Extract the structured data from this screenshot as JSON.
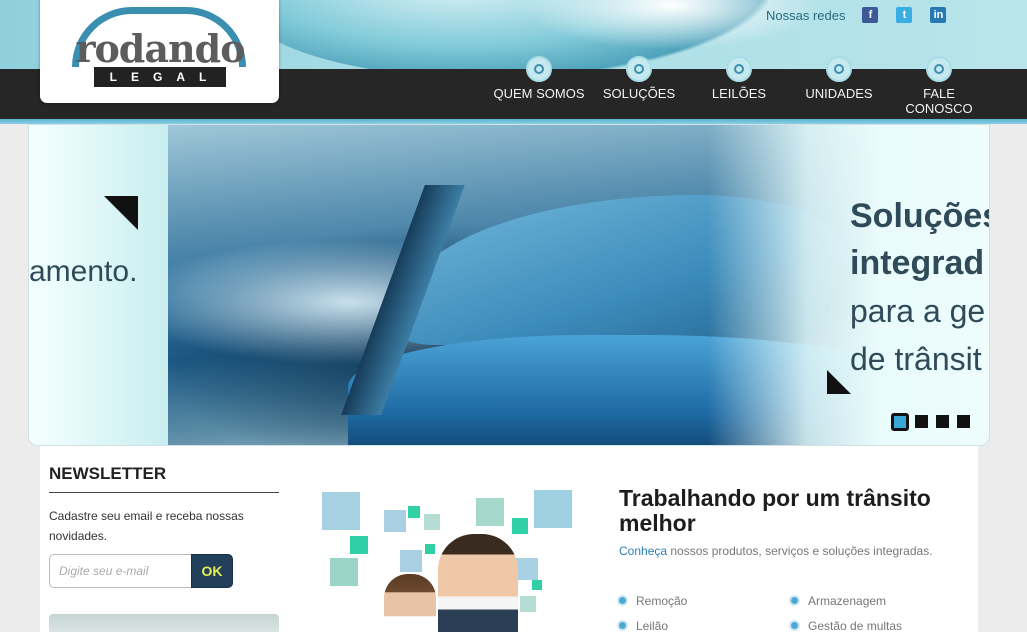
{
  "brand": {
    "logo_main": "rodando",
    "logo_sub": "LEGAL"
  },
  "social": {
    "label": "Nossas redes",
    "icons": [
      "facebook-icon",
      "twitter-icon",
      "linkedin-icon"
    ]
  },
  "nav": {
    "items": [
      {
        "label": "QUEM SOMOS"
      },
      {
        "label": "SOLUÇÕES"
      },
      {
        "label": "LEILÕES"
      },
      {
        "label": "UNIDADES"
      },
      {
        "label": "FALE CONOSCO"
      }
    ]
  },
  "slider": {
    "left_fragment": "amento.",
    "headline_line1": "Soluções",
    "headline_line2": "integrad",
    "headline_line3": "para a ge",
    "headline_line4": "de trânsit",
    "pages": 4,
    "active_page": 1
  },
  "newsletter": {
    "title": "NEWSLETTER",
    "description": "Cadastre seu email e receba nossas novidades.",
    "input_placeholder": "Digite seu e-mail",
    "button_label": "OK"
  },
  "feature": {
    "title": "Trabalhando por um trânsito melhor",
    "desc_link": "Conheça",
    "desc_rest": " nossos produtos, serviços e soluções integradas.",
    "items": [
      "Remoção",
      "Armazenagem",
      "Leilão",
      "Gestão de multas"
    ]
  },
  "colors": {
    "accent": "#3aa6d6",
    "nav_bg": "#262626",
    "ok_button": "#23405a",
    "ok_text": "#e5ef52"
  }
}
